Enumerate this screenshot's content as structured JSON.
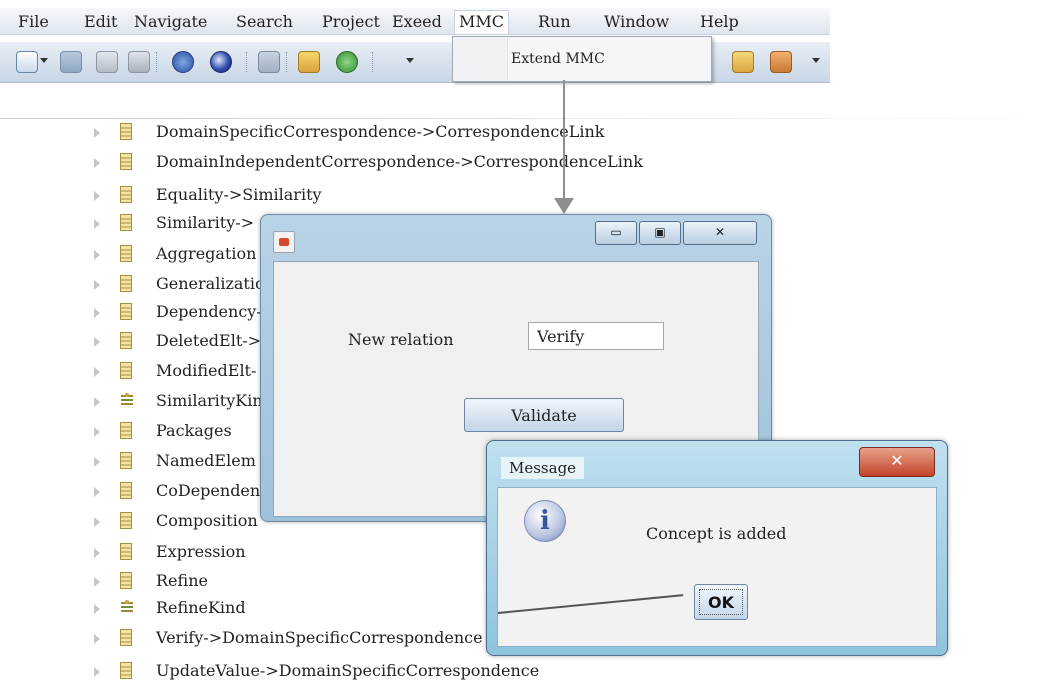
{
  "menubar": {
    "items": [
      {
        "label": "File"
      },
      {
        "label": "Edit"
      },
      {
        "label": "Navigate"
      },
      {
        "label": "Search"
      },
      {
        "label": "Project"
      },
      {
        "label": "Exeed"
      },
      {
        "label": "MMC",
        "active": true
      },
      {
        "label": "Run"
      },
      {
        "label": "Window"
      },
      {
        "label": "Help"
      }
    ]
  },
  "dropdown": {
    "items": [
      {
        "label": "Extend MMC"
      }
    ]
  },
  "toolbar": {
    "icons": [
      "new-icon",
      "save-icon",
      "copy-icon",
      "print-icon",
      "debug-icon",
      "run-icon",
      "search-icon",
      "build-icon",
      "refresh-icon",
      "open-folder-icon",
      "pencil-icon"
    ]
  },
  "tree": {
    "items": [
      {
        "label": "DomainSpecificCorrespondence->CorrespondenceLink",
        "icon": "class-icon"
      },
      {
        "label": "DomainIndependentCorrespondence->CorrespondenceLink",
        "icon": "class-icon"
      },
      {
        "label": "Equality->Similarity",
        "icon": "class-icon"
      },
      {
        "label": "Similarity->",
        "icon": "class-icon"
      },
      {
        "label": "Aggregation",
        "icon": "class-icon"
      },
      {
        "label": "Generalizatio",
        "icon": "class-icon"
      },
      {
        "label": "Dependency-",
        "icon": "class-icon"
      },
      {
        "label": "DeletedElt->",
        "icon": "class-icon"
      },
      {
        "label": "ModifiedElt-",
        "icon": "class-icon"
      },
      {
        "label": "SimilarityKino",
        "icon": "enum-icon"
      },
      {
        "label": "Packages",
        "icon": "class-icon"
      },
      {
        "label": "NamedElem",
        "icon": "class-icon"
      },
      {
        "label": "CoDependene",
        "icon": "class-icon"
      },
      {
        "label": "Composition",
        "icon": "class-icon"
      },
      {
        "label": "Expression",
        "icon": "class-icon"
      },
      {
        "label": "Refine",
        "icon": "class-icon"
      },
      {
        "label": "RefineKind",
        "icon": "enum-icon"
      },
      {
        "label": "Verify->DomainSpecificCorrespondence",
        "icon": "class-icon"
      },
      {
        "label": "UpdateValue->DomainSpecificCorrespondence",
        "icon": "class-icon"
      }
    ]
  },
  "relation_dialog": {
    "field_label": "New relation",
    "field_value": "Verify",
    "validate_label": "Validate",
    "minimize": "▭",
    "maximize": "▣",
    "close": "✕"
  },
  "message_dialog": {
    "title": "Message",
    "text": "Concept is added",
    "ok_label": "OK",
    "close": "✕",
    "info_glyph": "i"
  },
  "colors": {
    "menubar": "#e6ecf3",
    "dialog_frame": "#a9c9e0",
    "message_frame": "#9fcde3",
    "close_button": "#c9503a"
  }
}
